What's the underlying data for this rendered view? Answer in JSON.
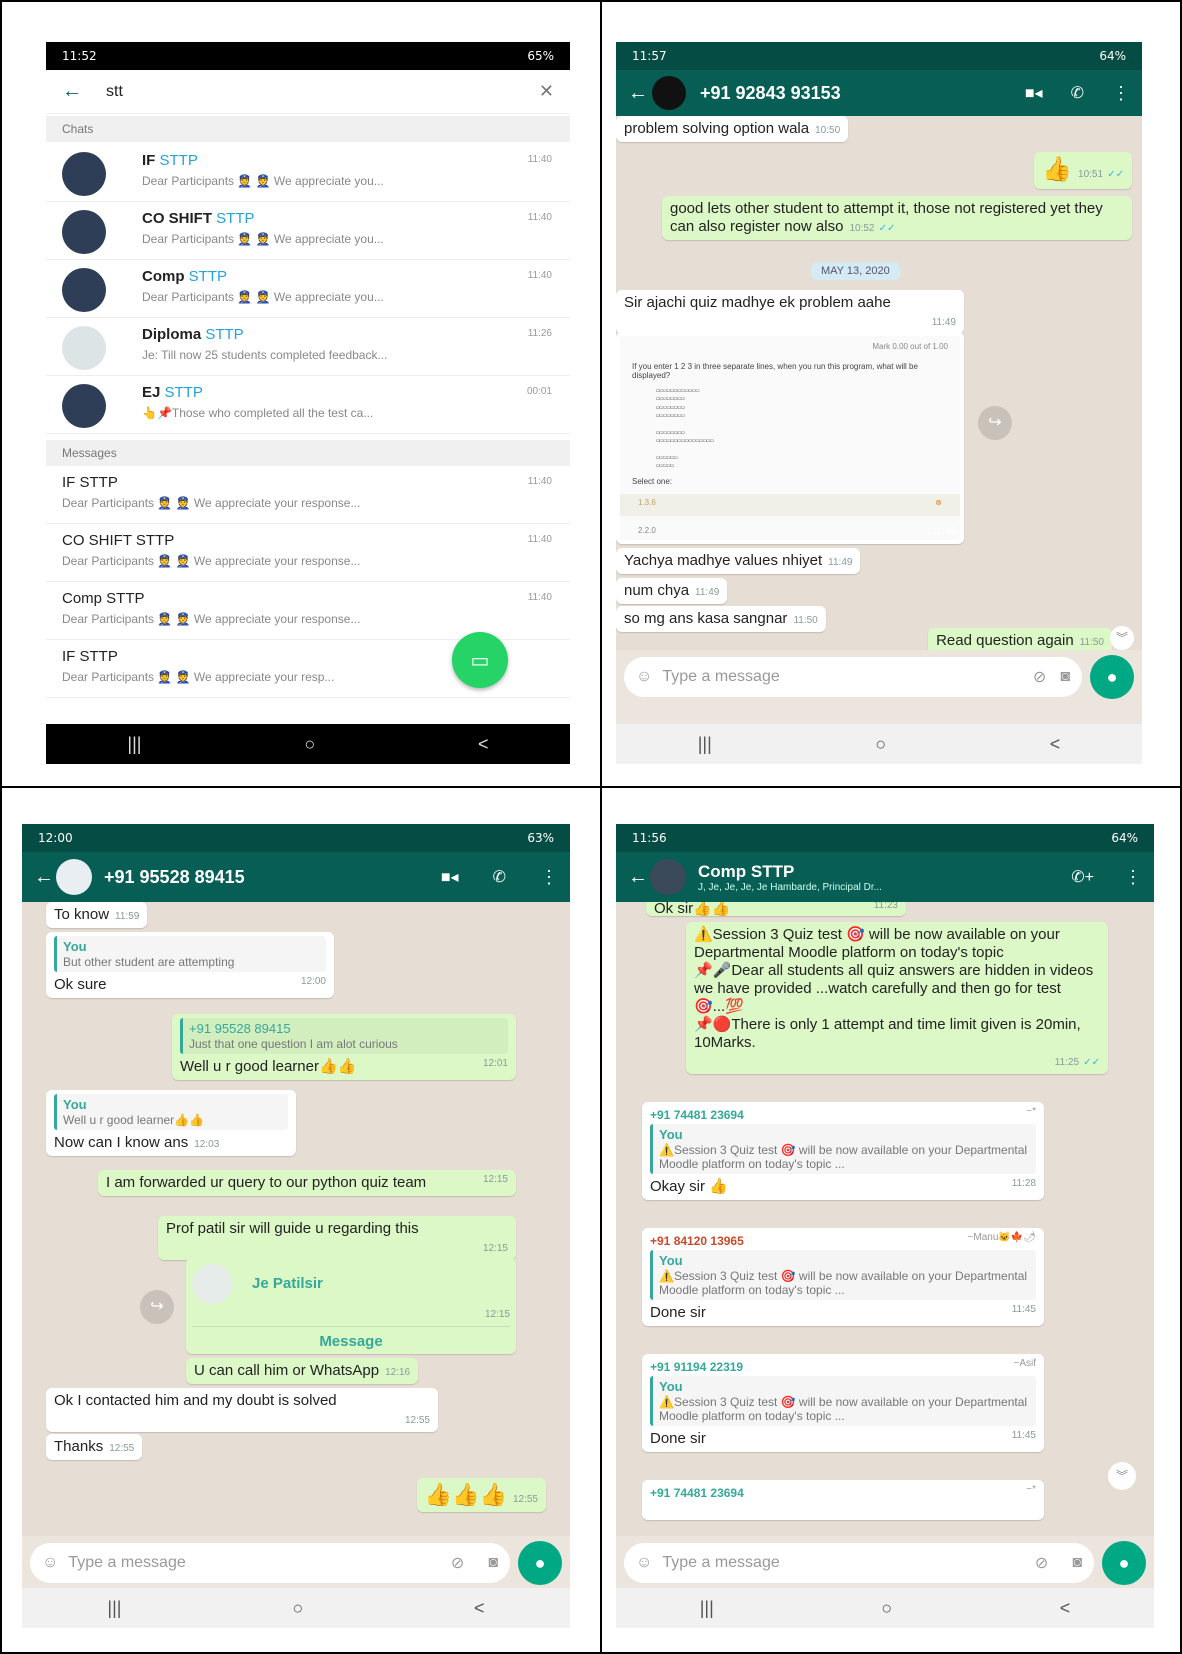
{
  "p1": {
    "status": {
      "time": "11:52",
      "right": "65%"
    },
    "search": {
      "value": "stt"
    },
    "sections": {
      "chats": "Chats",
      "messages": "Messages"
    },
    "chats": [
      {
        "pre": "IF ",
        "hl": "STTP",
        "post": "",
        "time": "11:40",
        "sub": "Dear Participants 👮 👮 We appreciate you..."
      },
      {
        "pre": "CO SHIFT ",
        "hl": "STTP",
        "post": "",
        "time": "11:40",
        "sub": "Dear Participants 👮 👮 We appreciate you..."
      },
      {
        "pre": "Comp ",
        "hl": "STTP",
        "post": "",
        "time": "11:40",
        "sub": "Dear Participants 👮 👮 We appreciate you..."
      },
      {
        "pre": "Diploma ",
        "hl": "STTP",
        "post": "",
        "time": "11:26",
        "sub": "Je: Till now 25 students completed feedback..."
      },
      {
        "pre": "EJ ",
        "hl": "STTP",
        "post": "",
        "time": "00:01",
        "sub": "👆📌Those who completed all the test ca..."
      }
    ],
    "messages": [
      {
        "name": "IF STTP",
        "time": "11:40",
        "sub": "Dear Participants 👮 👮 We appreciate your response..."
      },
      {
        "name": "CO SHIFT STTP",
        "time": "11:40",
        "sub": "Dear Participants 👮 👮 We appreciate your response..."
      },
      {
        "name": "Comp STTP",
        "time": "11:40",
        "sub": "Dear Participants 👮 👮 We appreciate your response..."
      },
      {
        "name": "IF STTP",
        "time": "",
        "sub": "Dear Participants 👮 👮 We appreciate your resp..."
      }
    ]
  },
  "p2": {
    "status": {
      "time": "11:57",
      "right": "64%"
    },
    "contact": "+91 92843 93153",
    "date_pill": "MAY 13, 2020",
    "msgs": {
      "m1": "problem solving option wala",
      "m1t": "10:50",
      "m2": "👍",
      "m2t": "10:51",
      "m3": "good lets other student to attempt it, those not registered yet they can also register now also",
      "m3t": "10:52",
      "m4": "Sir ajachi quiz madhye ek problem aahe",
      "m4t": "11:49",
      "img_mark": "Mark 0.00 out of 1.00",
      "img_q": "If you enter 1 2 3 in three separate lines, when you run this program, what will be displayed?",
      "img_select": "Select one:",
      "img_opt1": "1.3.6",
      "img_opt2": "2.2.0",
      "img_t": "11:49",
      "m5": "Yachya madhye values nhiyet",
      "m5t": "11:49",
      "m6": "num chya",
      "m6t": "11:49",
      "m7": "so mg ans kasa sangnar",
      "m7t": "11:50",
      "m8": "Read question again",
      "m8t": "11:50"
    },
    "input_placeholder": "Type a message"
  },
  "p3": {
    "status": {
      "time": "12:00",
      "right": "63%"
    },
    "contact": "+91 95528 89415",
    "msgs": {
      "m1": "To know",
      "m1t": "11:59",
      "q1who": "You",
      "q1": "But other student are attempting",
      "m2": "Ok sure",
      "m2t": "12:00",
      "q2who": "+91 95528 89415",
      "q2": "Just that one question I am alot curious",
      "m3": "Well u r good learner👍👍",
      "m3t": "12:01",
      "q3who": "You",
      "q3": "Well u r good learner👍👍",
      "m4": "Now can I know ans",
      "m4t": "12:03",
      "m5": "I am forwarded ur query to our  python quiz team",
      "m5t": "12:15",
      "m6": "Prof patil sir will guide u regarding this",
      "m6t": "12:15",
      "contact_name": "Je Patilsir",
      "contact_t": "12:15",
      "contact_btn": "Message",
      "m7": "U can call him or WhatsApp",
      "m7t": "12:16",
      "m8": "Ok I contacted him and my doubt is solved",
      "m8t": "12:55",
      "m9": "Thanks",
      "m9t": "12:55",
      "m10": "👍👍👍",
      "m10t": "12:55"
    },
    "input_placeholder": "Type a message"
  },
  "p4": {
    "status": {
      "time": "11:56",
      "right": "64%"
    },
    "group": "Comp STTP",
    "members": "J, Je, Je, Je, Je Hambarde, Principal Dr...",
    "msgs": {
      "m0": "Ok sir👍👍",
      "m0t": "11:23",
      "m1a": "⚠️Session 3 Quiz test 🎯 will be now available on your Departmental Moodle platform on today's topic",
      "m1b": "📌🎤Dear all students all quiz answers are hidden in videos we have provided ...watch carefully and then go for test🎯...💯",
      "m1c": "📌🔴There is only 1 attempt and time limit given is 20min, 10Marks.",
      "m1t": "11:25",
      "s1": "+91 74481 23694",
      "s1n": "~*",
      "qwho": "You",
      "q": "⚠️Session 3 Quiz test 🎯 will be now available on your Departmental Moodle platform on today's topic ...",
      "r1": "Okay sir 👍",
      "r1t": "11:28",
      "s2": "+91 84120 13965",
      "s2n": "~Manu🐱🍁🌶",
      "r2": "Done sir",
      "r2t": "11:45",
      "s3": "+91 91194 22319",
      "s3n": "~Asif",
      "r3": "Done sir",
      "r3t": "11:45",
      "s4": "+91 74481 23694",
      "s4n": "~*"
    },
    "input_placeholder": "Type a message"
  },
  "nav": {
    "recent": "|||",
    "home": "○",
    "back": "<"
  }
}
